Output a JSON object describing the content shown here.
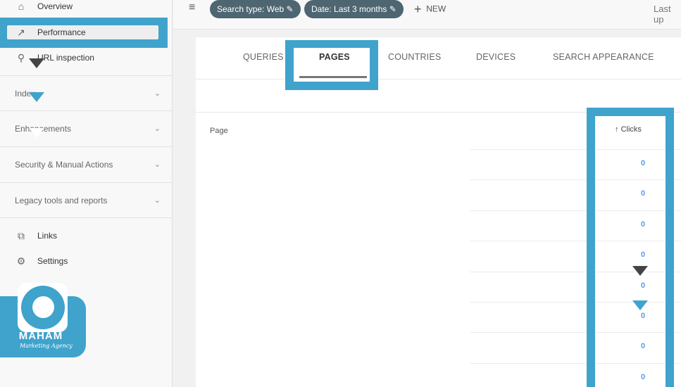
{
  "sidebar": {
    "items": [
      {
        "label": "Overview",
        "icon": "home-icon"
      },
      {
        "label": "Performance",
        "icon": "trending-up-icon"
      },
      {
        "label": "URL inspection",
        "icon": "search-icon"
      }
    ],
    "sections": [
      {
        "label": "Index"
      },
      {
        "label": "Enhancements"
      },
      {
        "label": "Security & Manual Actions"
      },
      {
        "label": "Legacy tools and reports"
      }
    ],
    "bottom": [
      {
        "label": "Links",
        "icon": "links-icon"
      },
      {
        "label": "Settings",
        "icon": "gear-icon"
      }
    ]
  },
  "logo": {
    "name": "MAHAM",
    "tagline": "Marketing Agency"
  },
  "toolbar": {
    "chips": [
      "Search type: Web",
      "Date: Last 3 months"
    ],
    "new_label": "NEW",
    "last_updated": "Last up"
  },
  "tabs": [
    "QUERIES",
    "PAGES",
    "COUNTRIES",
    "DEVICES",
    "SEARCH APPEARANCE"
  ],
  "active_tab": "PAGES",
  "table": {
    "headers": {
      "page": "Page",
      "clicks": "Clicks"
    },
    "clicks": [
      "0",
      "0",
      "0",
      "0",
      "0",
      "0",
      "0",
      "0"
    ]
  },
  "colors": {
    "highlight": "#3fa3cc",
    "chip": "#4d6672",
    "value": "#5b9be6"
  }
}
